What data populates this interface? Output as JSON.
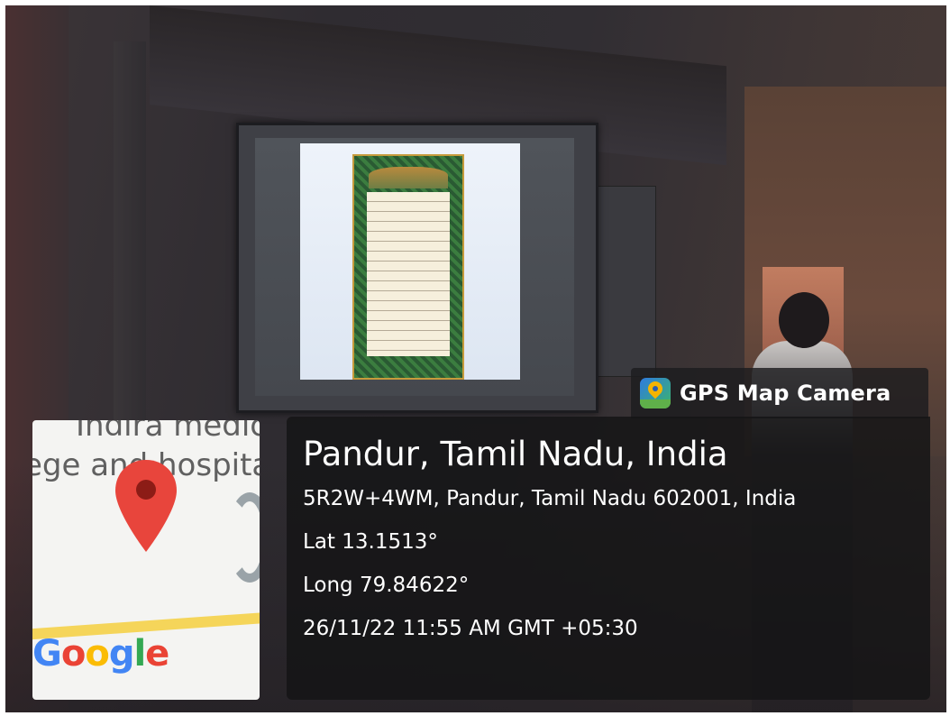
{
  "scene": {
    "description_icons": [
      "projector-screen",
      "document-on-slide",
      "person-silhouette"
    ]
  },
  "overlay": {
    "brand_label": "GPS Map Camera",
    "place_title": "Pandur, Tamil Nadu, India",
    "address": "5R2W+4WM, Pandur, Tamil Nadu 602001, India",
    "latitude": "Lat 13.1513°",
    "longitude": "Long 79.84622°",
    "timestamp": "26/11/22 11:55 AM GMT +05:30"
  },
  "map": {
    "label_line1": "Indira medic",
    "label_line2": "ege and hospita",
    "attribution": "Google",
    "pin_color": "#e8453c",
    "road_color": "#f5d55a"
  },
  "colors": {
    "overlay_bg": "#141416",
    "text": "#ffffff"
  }
}
